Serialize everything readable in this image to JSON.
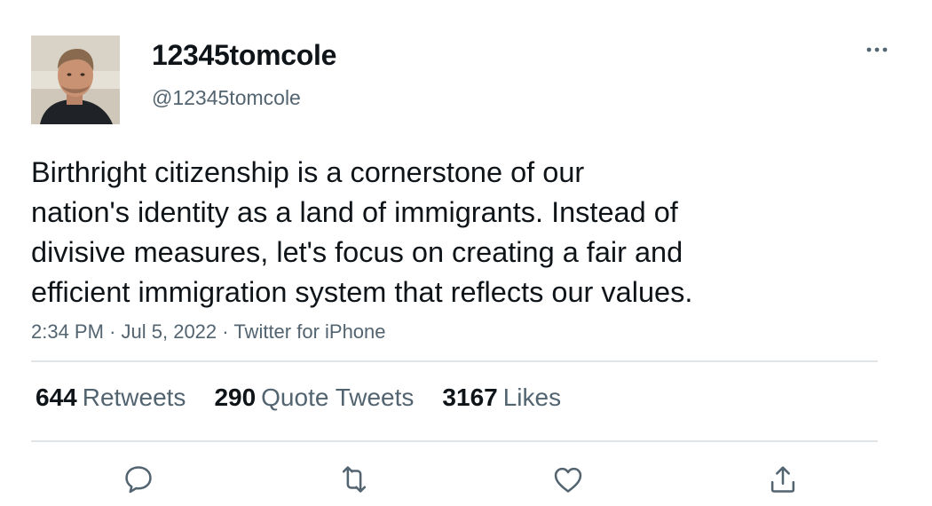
{
  "user": {
    "display_name": "12345tomcole",
    "handle": "@12345tomcole",
    "avatar_icon": "profile-photo"
  },
  "tweet": {
    "text": "Birthright citizenship is a cornerstone of our\nnation's identity as a land of immigrants. Instead of\ndivisive measures, let's focus on creating a fair and\nefficient immigration system that reflects our values.",
    "time": "2:34 PM",
    "separator": "·",
    "date": "Jul 5, 2022",
    "source": "Twitter for iPhone"
  },
  "stats": {
    "retweets_count": "644",
    "retweets_label": "Retweets",
    "quotes_count": "290",
    "quotes_label": "Quote Tweets",
    "likes_count": "3167",
    "likes_label": "Likes"
  },
  "actions": {
    "reply_icon": "reply-icon",
    "retweet_icon": "retweet-icon",
    "like_icon": "heart-icon",
    "share_icon": "share-icon",
    "more_icon": "more-dots-icon"
  },
  "colors": {
    "primary_text": "#0f1419",
    "secondary_text": "#536471",
    "divider": "#e1e4e7",
    "icon": "#536471"
  }
}
